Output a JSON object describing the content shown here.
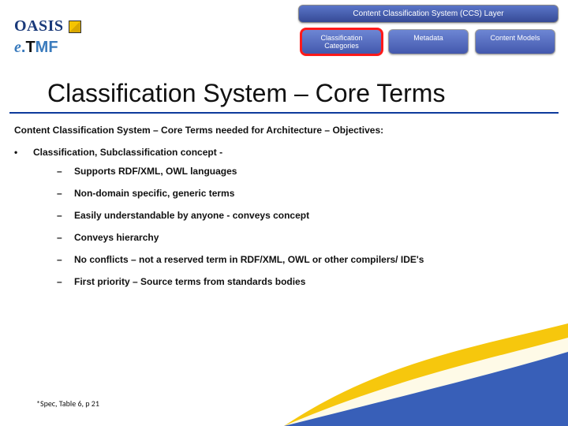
{
  "logos": {
    "oasis_part1": "OASIS",
    "etmf_e": "e",
    "etmf_dot": ".",
    "etmf_t": "T",
    "etmf_mf": "MF"
  },
  "layer_diagram": {
    "top": "Content Classification System (CCS) Layer",
    "items": [
      "Classification Categories",
      "Metadata",
      "Content Models"
    ],
    "highlighted_index": 0
  },
  "title": "Classification System – Core Terms",
  "subtitle": "Content Classification System – Core Terms needed for Architecture – Objectives:",
  "bullet_main": "Classification, Subclassification concept -",
  "sub_bullets": [
    "Supports RDF/XML, OWL languages",
    "Non-domain specific, generic terms",
    "Easily understandable by anyone -  conveys concept",
    "Conveys hierarchy",
    "No conflicts – not a reserved term in RDF/XML, OWL or other compilers/ IDE's",
    "First priority – Source terms from standards bodies"
  ],
  "footnote": "*Spec, Table 6, p 21"
}
